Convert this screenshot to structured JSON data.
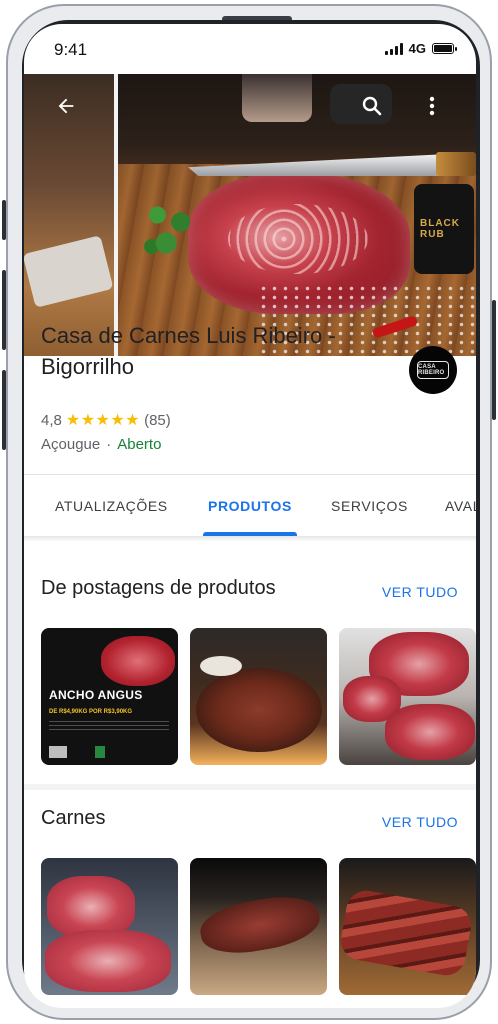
{
  "status_bar": {
    "time": "9:41",
    "network": "4G"
  },
  "hero": {
    "jar_label": "BLACK RUB"
  },
  "business": {
    "name": "Casa de Carnes Luis Ribeiro - Bigorrilho",
    "rating": "4,8",
    "stars": "★★★★★",
    "reviews": "(85)",
    "category": "Açougue",
    "separator": "·",
    "status": "Aberto",
    "logo_text": "CASA RIBEIRO"
  },
  "tabs": [
    {
      "label": "ATUALIZAÇÕES",
      "active": false
    },
    {
      "label": "PRODUTOS",
      "active": true
    },
    {
      "label": "SERVIÇOS",
      "active": false
    },
    {
      "label": "AVALIAÇÕES",
      "active": false
    }
  ],
  "sections": [
    {
      "title": "De postagens de produtos",
      "see_all": "VER TUDO"
    },
    {
      "title": "Carnes",
      "see_all": "VER TUDO"
    }
  ],
  "promo_thumb": {
    "title": "ANCHO ANGUS",
    "price": "DE R$4,90KG POR R$3,90KG"
  },
  "colors": {
    "accent": "#1a73e8",
    "open": "#188038",
    "star": "#fbbc04"
  }
}
